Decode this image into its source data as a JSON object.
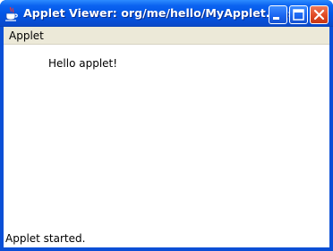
{
  "window": {
    "title": "Applet Viewer: org/me/hello/MyApplet.class",
    "icon": "java-cup-icon",
    "controls": [
      "minimize-icon",
      "maximize-icon",
      "close-icon"
    ]
  },
  "menubar": {
    "items": [
      {
        "label": "Applet"
      }
    ]
  },
  "applet": {
    "text": "Hello applet!"
  },
  "statusbar": {
    "text": "Applet started."
  },
  "colors": {
    "titlebar": "#0255e6",
    "menubar": "#ece9d8",
    "client": "#ffffff",
    "close_button": "#e04a23"
  }
}
